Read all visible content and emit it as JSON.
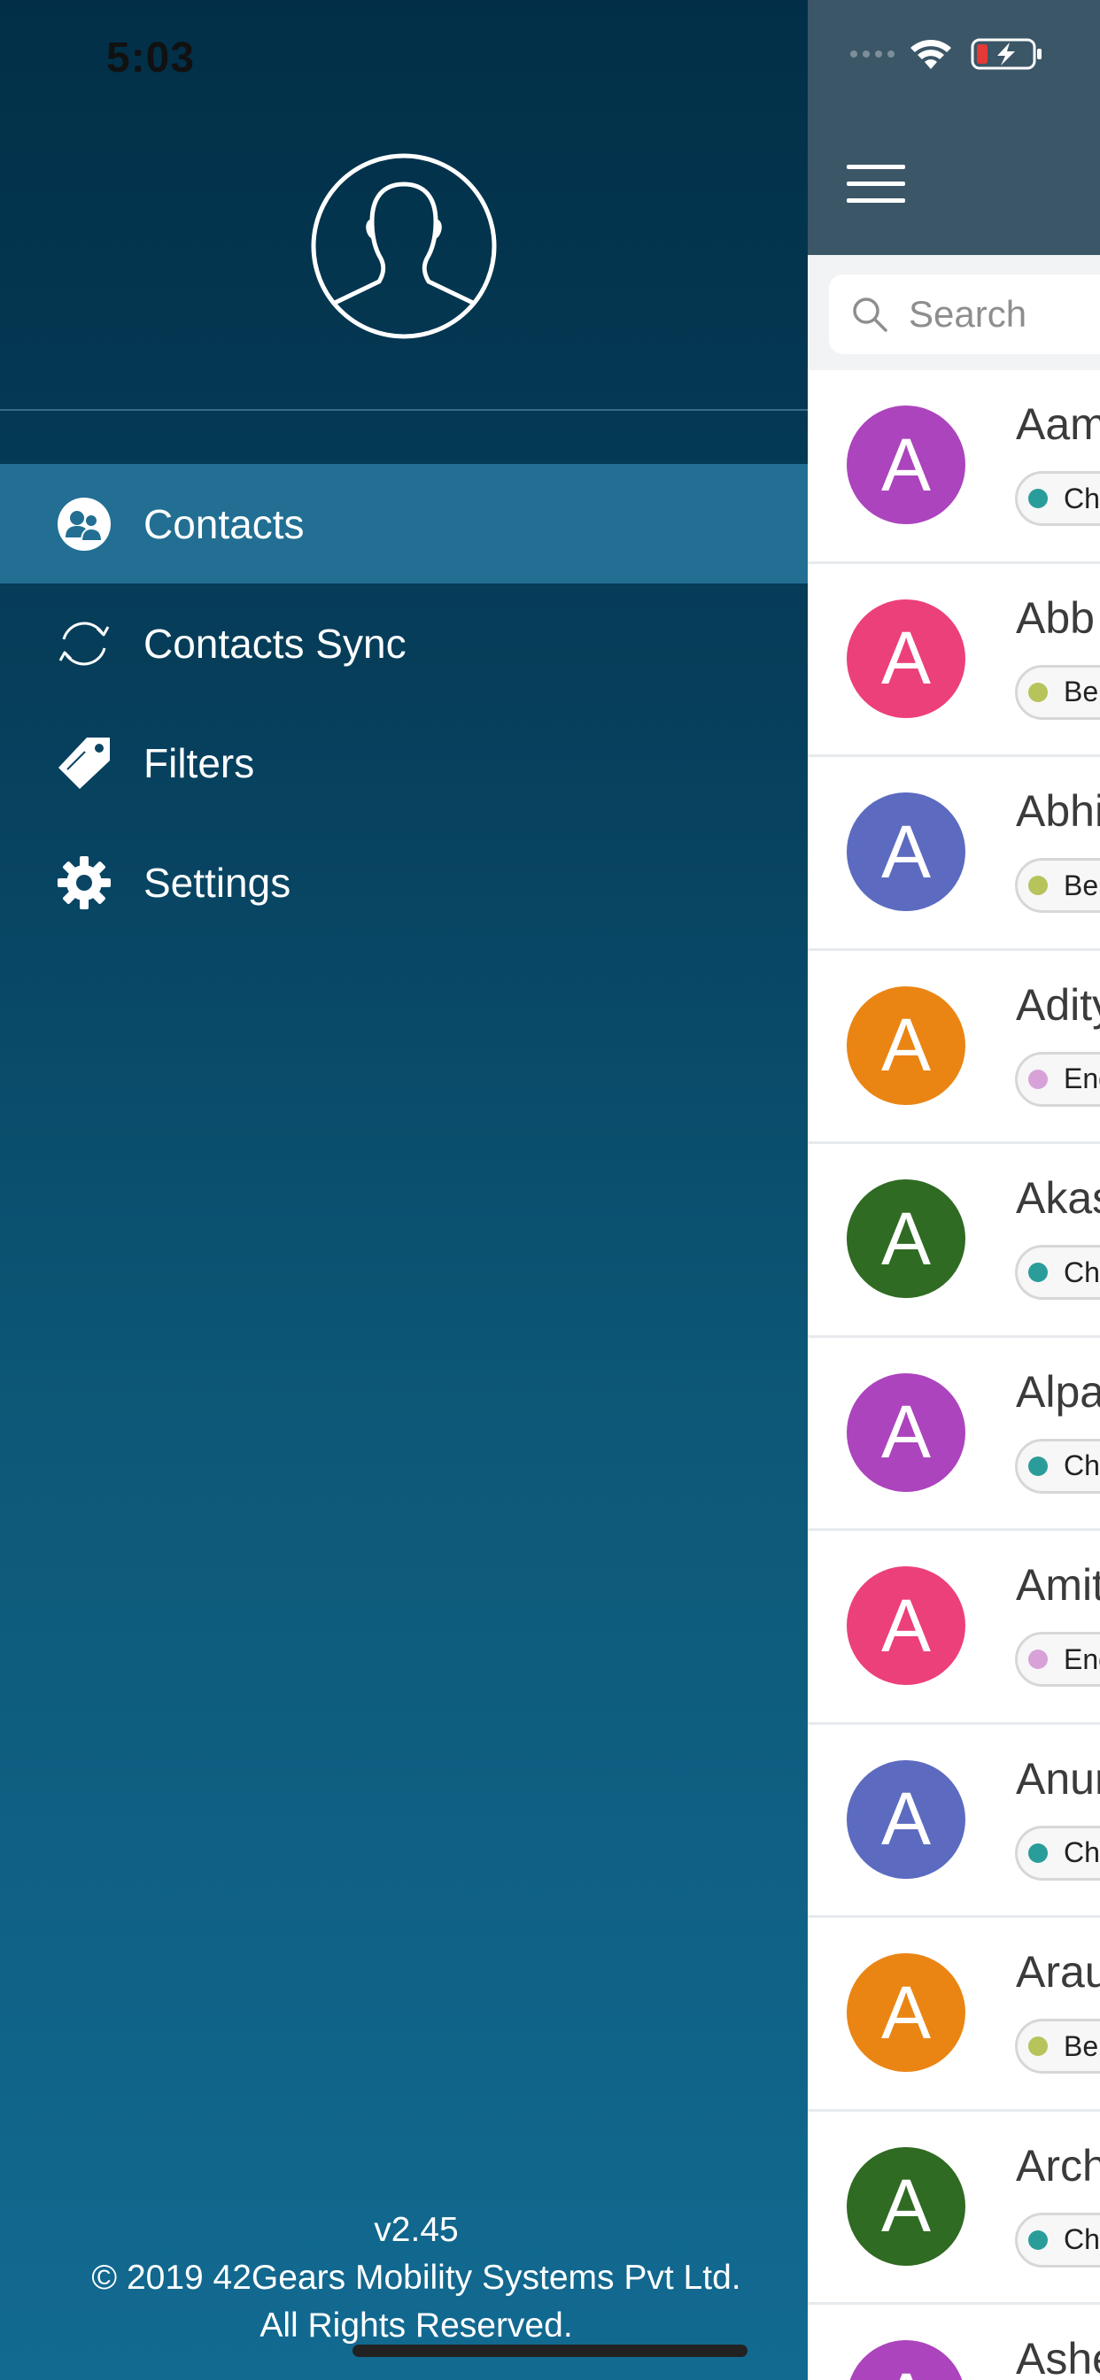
{
  "status_bar": {
    "time": "5:03"
  },
  "drawer": {
    "profile_icon": "user-silhouette-icon",
    "menu": [
      {
        "label": "Contacts",
        "icon": "contacts-icon",
        "active": true
      },
      {
        "label": "Contacts Sync",
        "icon": "sync-icon",
        "active": false
      },
      {
        "label": "Filters",
        "icon": "tag-icon",
        "active": false
      },
      {
        "label": "Settings",
        "icon": "gear-icon",
        "active": false
      }
    ],
    "footer": {
      "version": "v2.45",
      "copyright": "© 2019 42Gears Mobility Systems Pvt Ltd.",
      "rights": "All Rights Reserved."
    }
  },
  "main": {
    "search": {
      "placeholder": "Search"
    },
    "contacts": [
      {
        "initial": "A",
        "name": "Aam",
        "avatar_color": "#ac44bd",
        "tag": "Ch",
        "tag_color": "#2a9d9a"
      },
      {
        "initial": "A",
        "name": "Abb",
        "avatar_color": "#ec407a",
        "tag": "Ber",
        "tag_color": "#b7c35b"
      },
      {
        "initial": "A",
        "name": "Abhi",
        "avatar_color": "#5c6bc0",
        "tag": "Ber",
        "tag_color": "#b7c35b"
      },
      {
        "initial": "A",
        "name": "Adity",
        "avatar_color": "#ea8514",
        "tag": "Eng",
        "tag_color": "#d8a2d8"
      },
      {
        "initial": "A",
        "name": "Akas",
        "avatar_color": "#2f6b22",
        "tag": "Ch",
        "tag_color": "#2a9d9a"
      },
      {
        "initial": "A",
        "name": "Alpa",
        "avatar_color": "#ac44bd",
        "tag": "Ch",
        "tag_color": "#2a9d9a"
      },
      {
        "initial": "A",
        "name": "Amit",
        "avatar_color": "#ec407a",
        "tag": "Eng",
        "tag_color": "#d8a2d8"
      },
      {
        "initial": "A",
        "name": "Anur",
        "avatar_color": "#5c6bc0",
        "tag": "Ch",
        "tag_color": "#2a9d9a"
      },
      {
        "initial": "A",
        "name": "Arau",
        "avatar_color": "#ea8514",
        "tag": "Ber",
        "tag_color": "#b7c35b"
      },
      {
        "initial": "A",
        "name": "Arch",
        "avatar_color": "#2f6b22",
        "tag": "Ch",
        "tag_color": "#2a9d9a"
      },
      {
        "initial": "A",
        "name": "Ashe",
        "avatar_color": "#ac44bd",
        "tag": "",
        "tag_color": "#2a9d9a"
      }
    ]
  }
}
